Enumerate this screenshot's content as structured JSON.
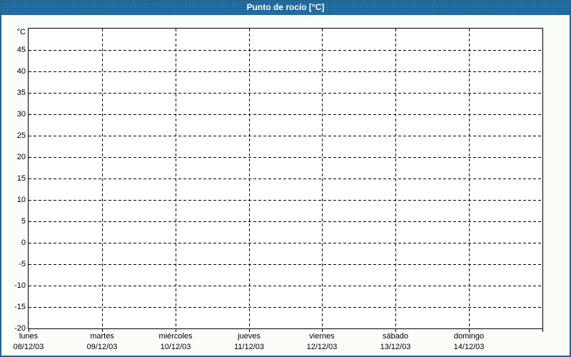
{
  "window": {
    "title": "Punto de rocío [°C]"
  },
  "colors": {
    "titlebar_bg": "#1c6aa0",
    "titlebar_text": "#ffffff",
    "frame_border": "#26648e",
    "page_bg": "#fbfdf9",
    "plot_bg": "#fefffe",
    "plot_border": "#000000",
    "grid": "#000000",
    "axis_text": "#000000"
  },
  "chart_data": {
    "type": "line",
    "title": "Punto de rocío [°C]",
    "ylabel": "°C",
    "y_unit_label": "°C",
    "ylim": [
      -20,
      50
    ],
    "y_tick_step": 5,
    "y_tick_labels": [
      45,
      40,
      35,
      30,
      25,
      20,
      15,
      10,
      5,
      0,
      -5,
      -10,
      -15,
      -20
    ],
    "grid": true,
    "grid_style": "dashed",
    "legend": "none",
    "series": [],
    "x_categories": [
      {
        "name": "lunes",
        "date": "08/12/03"
      },
      {
        "name": "martes",
        "date": "09/12/03"
      },
      {
        "name": "miércoles",
        "date": "10/12/03"
      },
      {
        "name": "jueves",
        "date": "11/12/03"
      },
      {
        "name": "viernes",
        "date": "12/12/03"
      },
      {
        "name": "sábado",
        "date": "13/12/03"
      },
      {
        "name": "domingo",
        "date": "14/12/03"
      }
    ]
  }
}
